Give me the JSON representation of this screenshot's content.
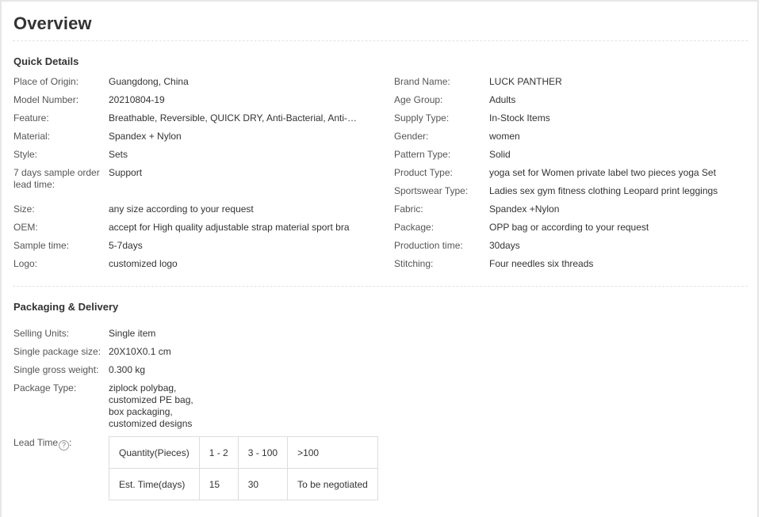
{
  "overview_title": "Overview",
  "quick_details": {
    "heading": "Quick Details",
    "left": [
      {
        "label": "Place of Origin:",
        "value": "Guangdong, China"
      },
      {
        "label": "Model Number:",
        "value": "20210804-19"
      },
      {
        "label": "Feature:",
        "value": "Breathable, Reversible, QUICK DRY, Anti-Bacterial, Anti-UV, A..."
      },
      {
        "label": "Material:",
        "value": "Spandex + Nylon"
      },
      {
        "label": "Style:",
        "value": "Sets"
      },
      {
        "label": "7 days sample order lead time:",
        "value": "Support"
      },
      {
        "label": "Size:",
        "value": "any size according to your request"
      },
      {
        "label": "OEM:",
        "value": "accept for High quality adjustable strap material sport bra"
      },
      {
        "label": "Sample time:",
        "value": "5-7days"
      },
      {
        "label": "Logo:",
        "value": "customized logo"
      }
    ],
    "right": [
      {
        "label": "Brand Name:",
        "value": "LUCK PANTHER"
      },
      {
        "label": "Age Group:",
        "value": "Adults"
      },
      {
        "label": "Supply Type:",
        "value": "In-Stock Items"
      },
      {
        "label": "Gender:",
        "value": "women"
      },
      {
        "label": "Pattern Type:",
        "value": "Solid"
      },
      {
        "label": "Product Type:",
        "value": "yoga set for Women private label two pieces yoga Set"
      },
      {
        "label": "Sportswear Type:",
        "value": "Ladies sex gym fitness clothing Leopard print leggings"
      },
      {
        "label": "Fabric:",
        "value": "Spandex +Nylon"
      },
      {
        "label": "Package:",
        "value": "OPP bag or according to your request"
      },
      {
        "label": "Production time:",
        "value": "30days"
      },
      {
        "label": "Stitching:",
        "value": "Four needles six threads"
      }
    ]
  },
  "packaging": {
    "heading": "Packaging & Delivery",
    "rows": [
      {
        "label": "Selling Units:",
        "value": "Single item"
      },
      {
        "label": "Single package size:",
        "value": "20X10X0.1 cm"
      },
      {
        "label": "Single gross weight:",
        "value": "0.300 kg"
      },
      {
        "label": "Package Type:",
        "value": "ziplock polybag,\ncustomized PE bag,\nbox packaging,\ncustomized designs"
      }
    ],
    "lead_time_label": "Lead Time",
    "lead_time_colon": ":",
    "help_icon": "question-circle-icon",
    "help_glyph": "?",
    "lead_table": {
      "quantity_header": "Quantity(Pieces)",
      "quantities": [
        "1 - 2",
        "3 - 100",
        ">100"
      ],
      "time_header": "Est. Time(days)",
      "times": [
        "15",
        "30",
        "To be negotiated"
      ]
    }
  }
}
